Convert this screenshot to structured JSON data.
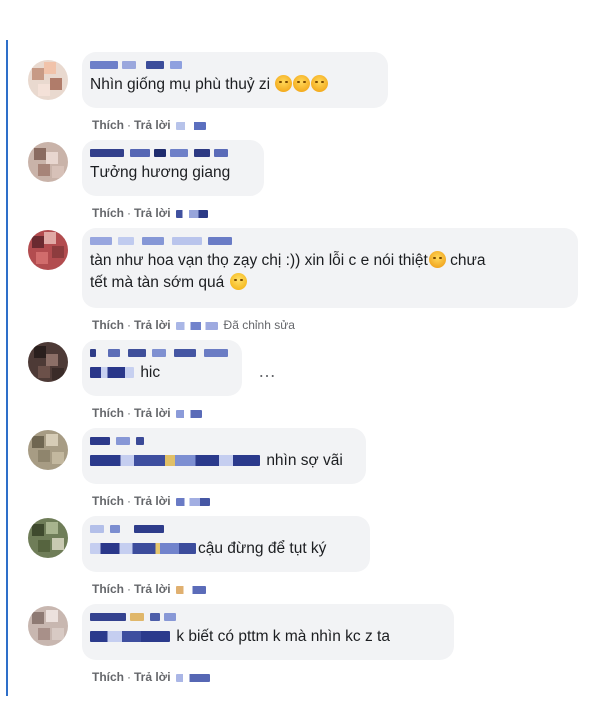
{
  "actions": {
    "like": "Thích",
    "reply": "Trả lời",
    "separator": "·"
  },
  "comments": [
    {
      "text": "Nhìn giống mụ phù thuỷ zi",
      "emojis": [
        "sad",
        "sad",
        "sad"
      ]
    },
    {
      "text": "Tưởng hương giang"
    },
    {
      "text": "tàn như hoa vạn thọ zạy chị :)) xin lỗi c e nói thiệt",
      "text_after_emoji": "chưa",
      "text_line2": "tết mà tàn sớm quá",
      "edited": "Đã chỉnh sửa"
    },
    {
      "text": "hic",
      "more": "…"
    },
    {
      "text": "nhìn sợ vãi"
    },
    {
      "text": "cậu đừng để tụt ký"
    },
    {
      "text": "k biết có pttm k mà nhìn kc z ta"
    }
  ],
  "colors": {
    "thread_line": "#2e6fc9",
    "bubble": "#f2f3f5",
    "muted": "#65676b"
  }
}
